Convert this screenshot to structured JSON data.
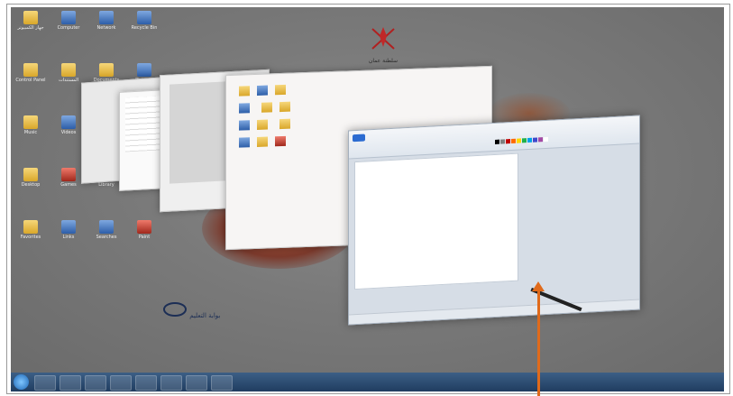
{
  "desktop": {
    "icons": [
      {
        "label": "جهاز الكمبيوتر",
        "kind": "folder"
      },
      {
        "label": "Computer",
        "kind": "blue"
      },
      {
        "label": "Network",
        "kind": "blue"
      },
      {
        "label": "Recycle Bin",
        "kind": "blue"
      },
      {
        "label": "Control Panel",
        "kind": "folder"
      },
      {
        "label": "المستندات",
        "kind": "folder"
      },
      {
        "label": "Documents",
        "kind": "folder"
      },
      {
        "label": "Pictures",
        "kind": "blue"
      },
      {
        "label": "Music",
        "kind": "folder"
      },
      {
        "label": "Videos",
        "kind": "blue"
      },
      {
        "label": "Downloads",
        "kind": "folder"
      },
      {
        "label": "الصور",
        "kind": "folder"
      },
      {
        "label": "Desktop",
        "kind": "folder"
      },
      {
        "label": "Games",
        "kind": "red"
      },
      {
        "label": "Library",
        "kind": "folder"
      },
      {
        "label": "Contacts",
        "kind": "blue"
      },
      {
        "label": "Favorites",
        "kind": "folder"
      },
      {
        "label": "Links",
        "kind": "blue"
      },
      {
        "label": "Searches",
        "kind": "blue"
      },
      {
        "label": "Paint",
        "kind": "red"
      }
    ],
    "watermark": "بوابة التعليم",
    "emblem_text": "سلطنة عمان"
  },
  "paint": {
    "palette": [
      "#000000",
      "#7f7f7f",
      "#c00000",
      "#ff6a00",
      "#ffd800",
      "#22b14c",
      "#00a2e8",
      "#3f48cc",
      "#a349a4",
      "#ffffff"
    ]
  },
  "taskbar": {
    "buttons": [
      "ie",
      "folder",
      "media",
      "chrome",
      "paint",
      "word",
      "mail",
      "steam"
    ],
    "clock": ""
  },
  "annotation": {
    "arrow_color": "#e06a1b"
  }
}
